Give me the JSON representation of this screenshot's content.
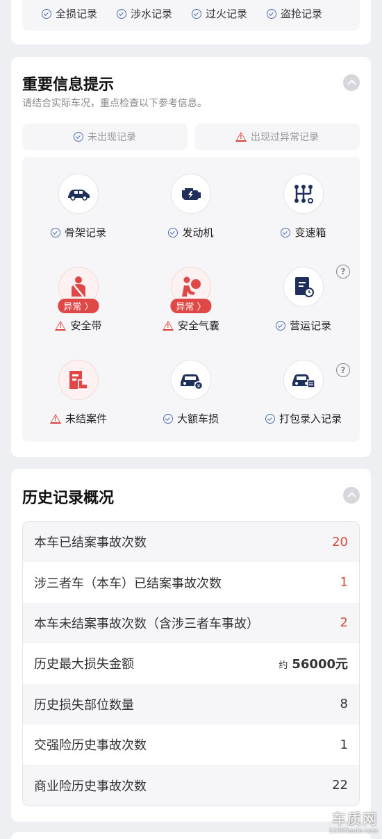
{
  "top_section": {
    "items": [
      "全损记录",
      "涉水记录",
      "过火记录",
      "盗抢记录"
    ]
  },
  "important_info": {
    "title": "重要信息提示",
    "subtitle": "请结合实际车况，重点检查以下参考信息。",
    "legend_normal": "未出现记录",
    "legend_abnormal": "出现过异常记录",
    "badge_label": "异常 〉",
    "help_label": "?",
    "items": [
      {
        "label": "骨架记录",
        "status": "normal",
        "icon": "car-frame-icon"
      },
      {
        "label": "发动机",
        "status": "normal",
        "icon": "engine-icon"
      },
      {
        "label": "变速箱",
        "status": "normal",
        "icon": "gearbox-icon"
      },
      {
        "label": "安全带",
        "status": "abnormal",
        "icon": "seatbelt-icon"
      },
      {
        "label": "安全气囊",
        "status": "abnormal",
        "icon": "airbag-icon"
      },
      {
        "label": "营运记录",
        "status": "normal",
        "icon": "operation-record-icon"
      },
      {
        "label": "未结案件",
        "status": "abnormal",
        "icon": "open-case-icon"
      },
      {
        "label": "大额车损",
        "status": "normal",
        "icon": "major-damage-icon"
      },
      {
        "label": "打包录入记录",
        "status": "normal",
        "icon": "bundle-entry-icon"
      }
    ]
  },
  "history": {
    "title": "历史记录概况",
    "rows": [
      {
        "label": "本车已结案事故次数",
        "value": "20",
        "highlight": true
      },
      {
        "label": "涉三者车（本车）已结案事故次数",
        "value": "1",
        "highlight": true
      },
      {
        "label": "本车未结案事故次数（含涉三者车事故）",
        "value": "2",
        "highlight": true
      },
      {
        "label": "历史最大损失金额",
        "prefix": "约",
        "value": "56000元",
        "bold": true
      },
      {
        "label": "历史损失部位数量",
        "value": "8"
      },
      {
        "label": "交强险历史事故次数",
        "value": "1"
      },
      {
        "label": "商业险历史事故次数",
        "value": "22"
      }
    ]
  },
  "watermark": {
    "brand": "车质网",
    "url": "12365auto.com"
  }
}
